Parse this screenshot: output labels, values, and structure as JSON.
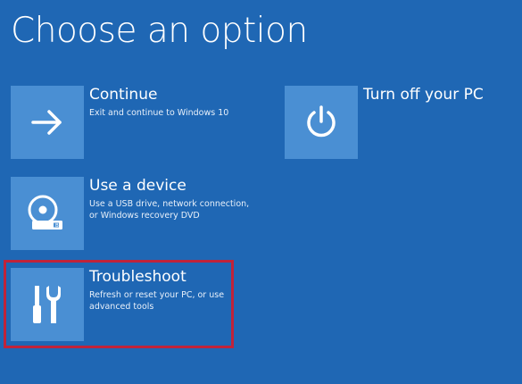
{
  "page": {
    "title": "Choose an option"
  },
  "options": [
    {
      "id": "continue",
      "title": "Continue",
      "description_lines": [
        "Exit and continue to Windows 10"
      ],
      "icon": "arrow-right-icon"
    },
    {
      "id": "use-device",
      "title": "Use a device",
      "description_lines": [
        "Use a USB drive, network connection,",
        "or Windows recovery DVD"
      ],
      "icon": "disc-drive-icon"
    },
    {
      "id": "troubleshoot",
      "title": "Troubleshoot",
      "description_lines": [
        "Refresh or reset your PC, or use",
        "advanced tools"
      ],
      "icon": "tools-icon",
      "highlighted": true
    },
    {
      "id": "turn-off",
      "title": "Turn off your PC",
      "description_lines": [],
      "icon": "power-icon"
    }
  ],
  "colors": {
    "background": "#1f67b4",
    "tile": "#4a8fd3",
    "text": "#ffffff",
    "highlight_border": "#c0233a"
  }
}
